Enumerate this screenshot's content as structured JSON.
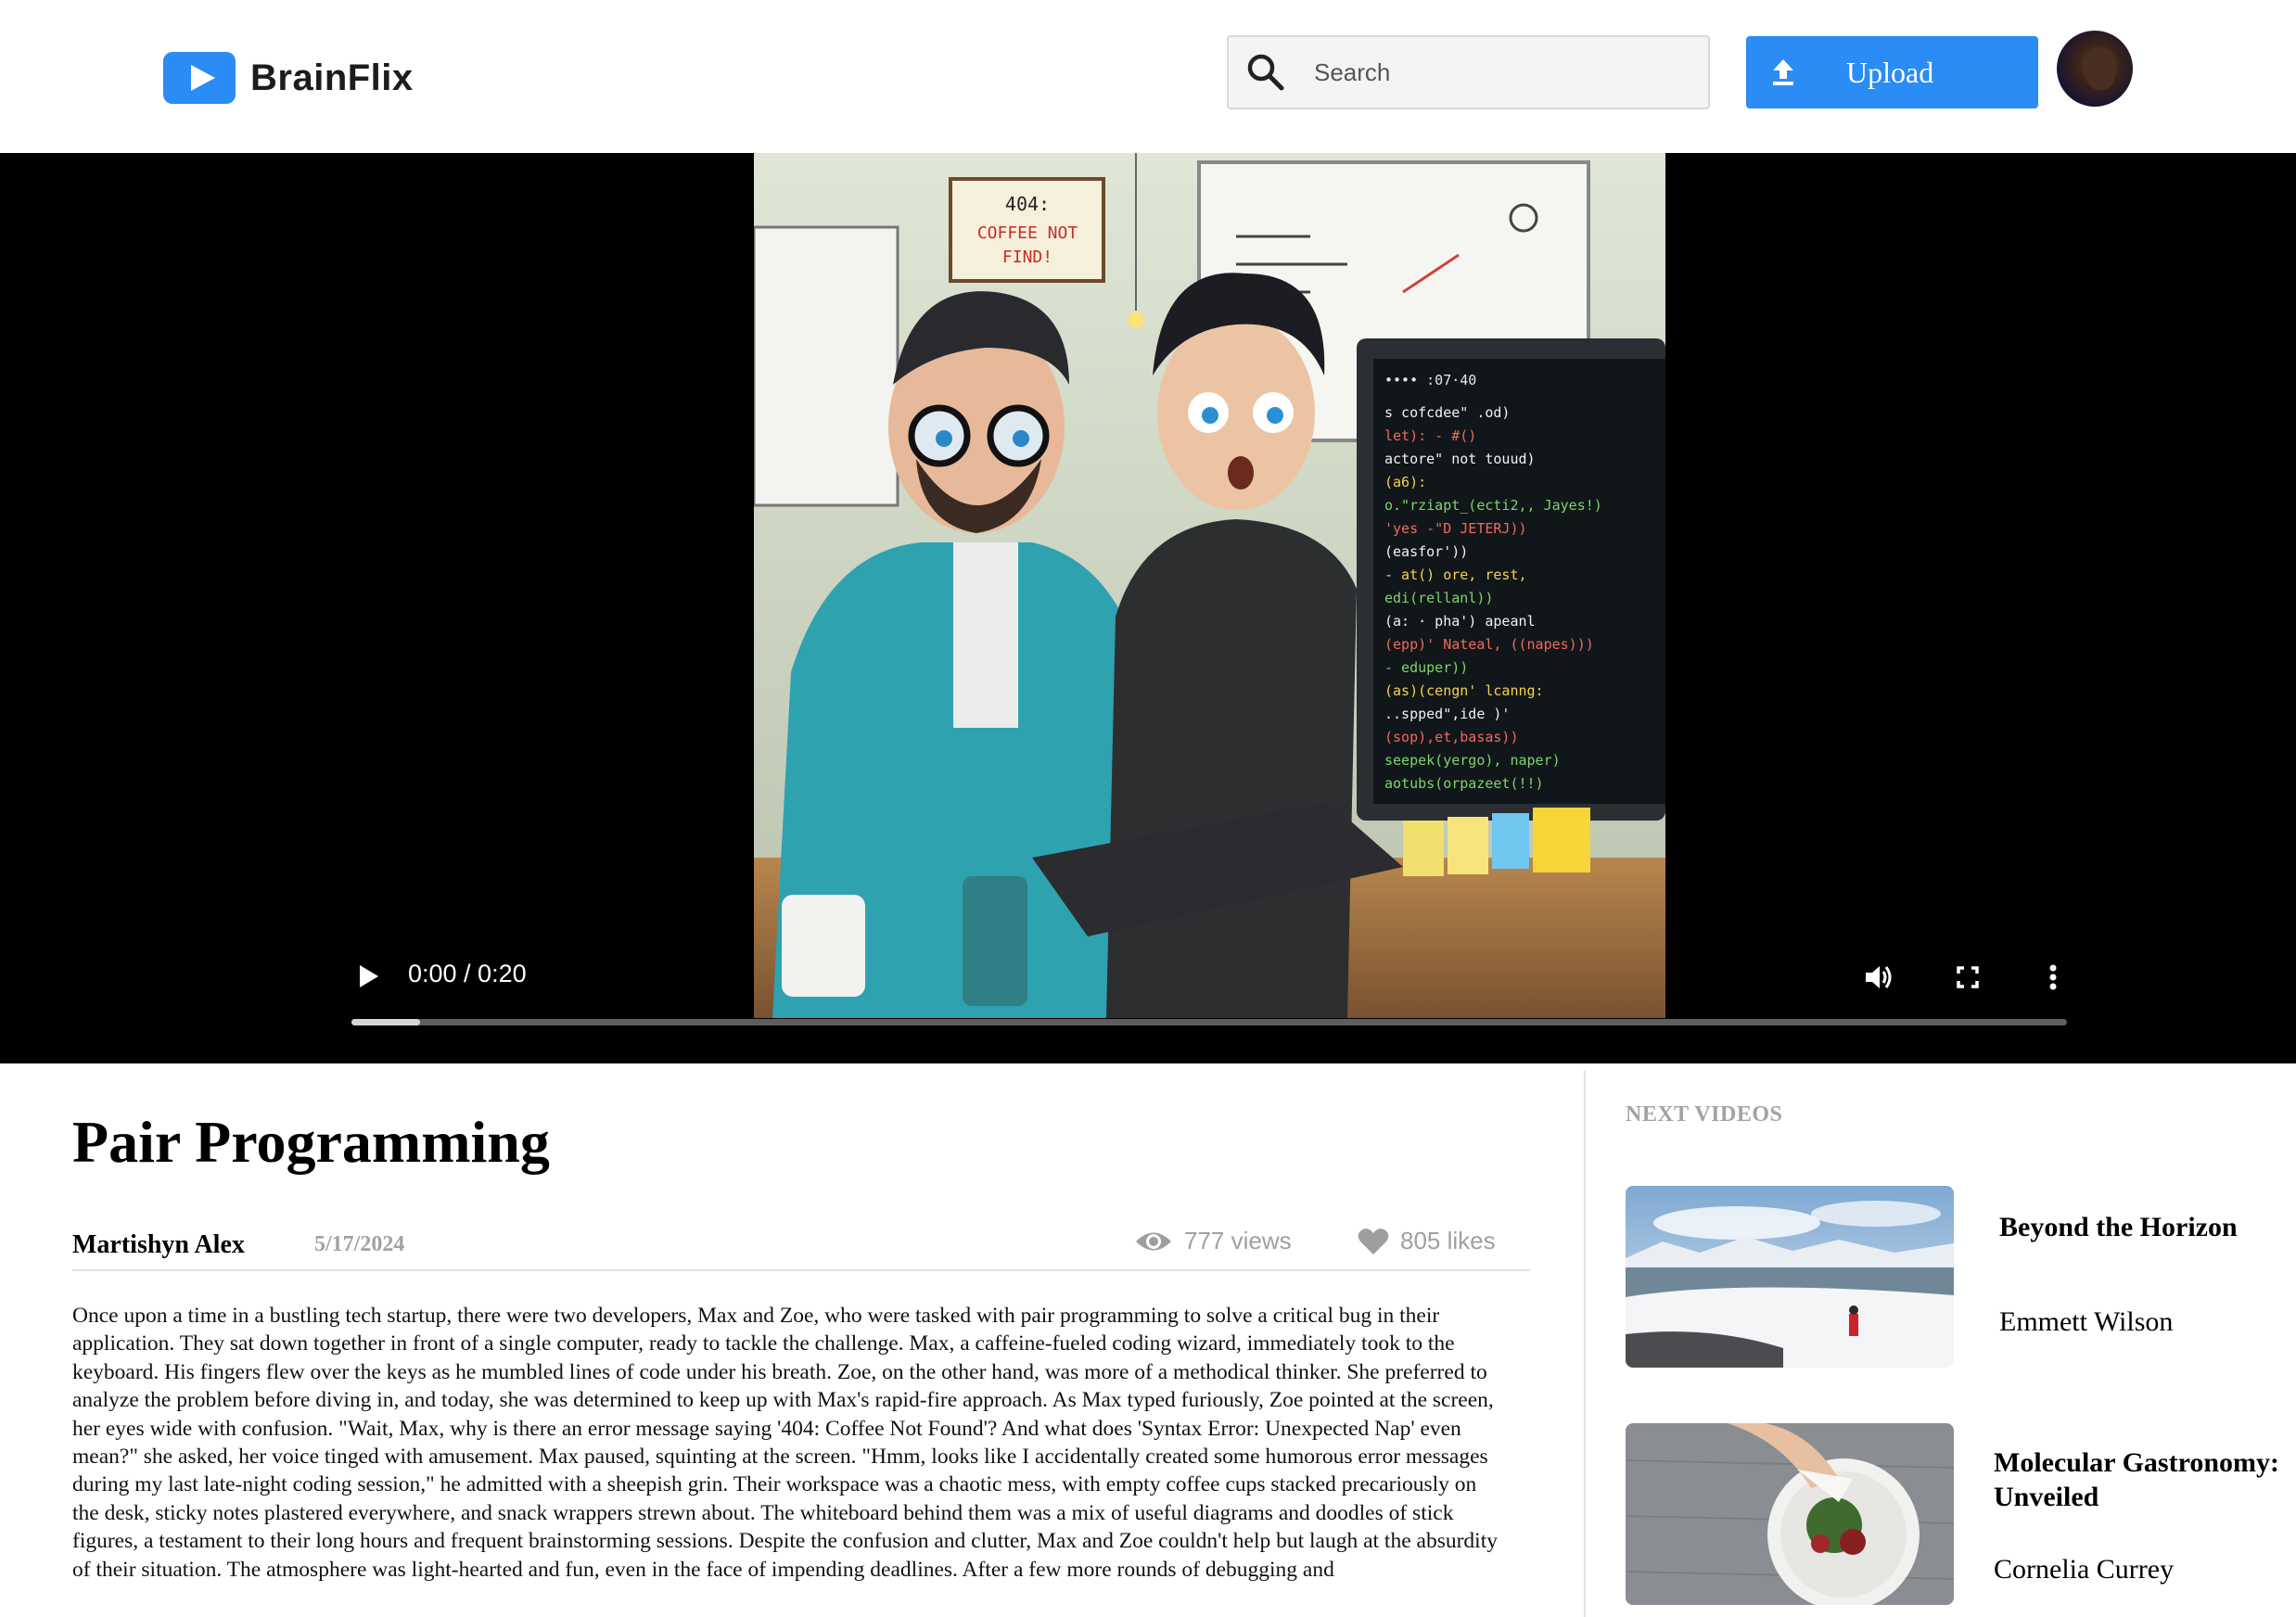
{
  "header": {
    "brand": "BrainFlix",
    "search_placeholder": "Search",
    "upload_label": "Upload"
  },
  "player": {
    "time": "0:00 / 0:20",
    "progress_fraction": 0.04
  },
  "video": {
    "title": "Pair Programming",
    "author": "Martishyn Alex",
    "date": "5/17/2024",
    "views": "777 views",
    "likes": "805 likes",
    "description": "Once upon a time in a bustling tech startup, there were two developers, Max and Zoe, who were tasked with pair programming to solve a critical bug in their application. They sat down together in front of a single computer, ready to tackle the challenge. Max, a caffeine-fueled coding wizard, immediately took to the keyboard. His fingers flew over the keys as he mumbled lines of code under his breath. Zoe, on the other hand, was more of a methodical thinker. She preferred to analyze the problem before diving in, and today, she was determined to keep up with Max's rapid-fire approach. As Max typed furiously, Zoe pointed at the screen, her eyes wide with confusion. \"Wait, Max, why is there an error message saying '404: Coffee Not Found'? And what does 'Syntax Error: Unexpected Nap' even mean?\" she asked, her voice tinged with amusement. Max paused, squinting at the screen. \"Hmm, looks like I accidentally created some humorous error messages during my last late-night coding session,\" he admitted with a sheepish grin. Their workspace was a chaotic mess, with empty coffee cups stacked precariously on the desk, sticky notes plastered everywhere, and snack wrappers strewn about. The whiteboard behind them was a mix of useful diagrams and doodles of stick figures, a testament to their long hours and frequent brainstorming sessions. Despite the confusion and clutter, Max and Zoe couldn't help but laugh at the absurdity of their situation. The atmosphere was light-hearted and fun, even in the face of impending deadlines. After a few more rounds of debugging and"
  },
  "sidebar": {
    "heading": "NEXT VIDEOS",
    "items": [
      {
        "title": "Beyond the Horizon",
        "author": "Emmett Wilson"
      },
      {
        "title": "Molecular Gastronomy: Unveiled",
        "author": "Cornelia Currey"
      }
    ]
  },
  "colors": {
    "brand_blue": "#2a8cf4",
    "muted_text": "#a0a0a0"
  },
  "icons": [
    "play-logo-icon",
    "search-icon",
    "upload-icon",
    "avatar",
    "play-icon",
    "volume-icon",
    "fullscreen-icon",
    "more-vert-icon",
    "eye-icon",
    "heart-icon"
  ]
}
